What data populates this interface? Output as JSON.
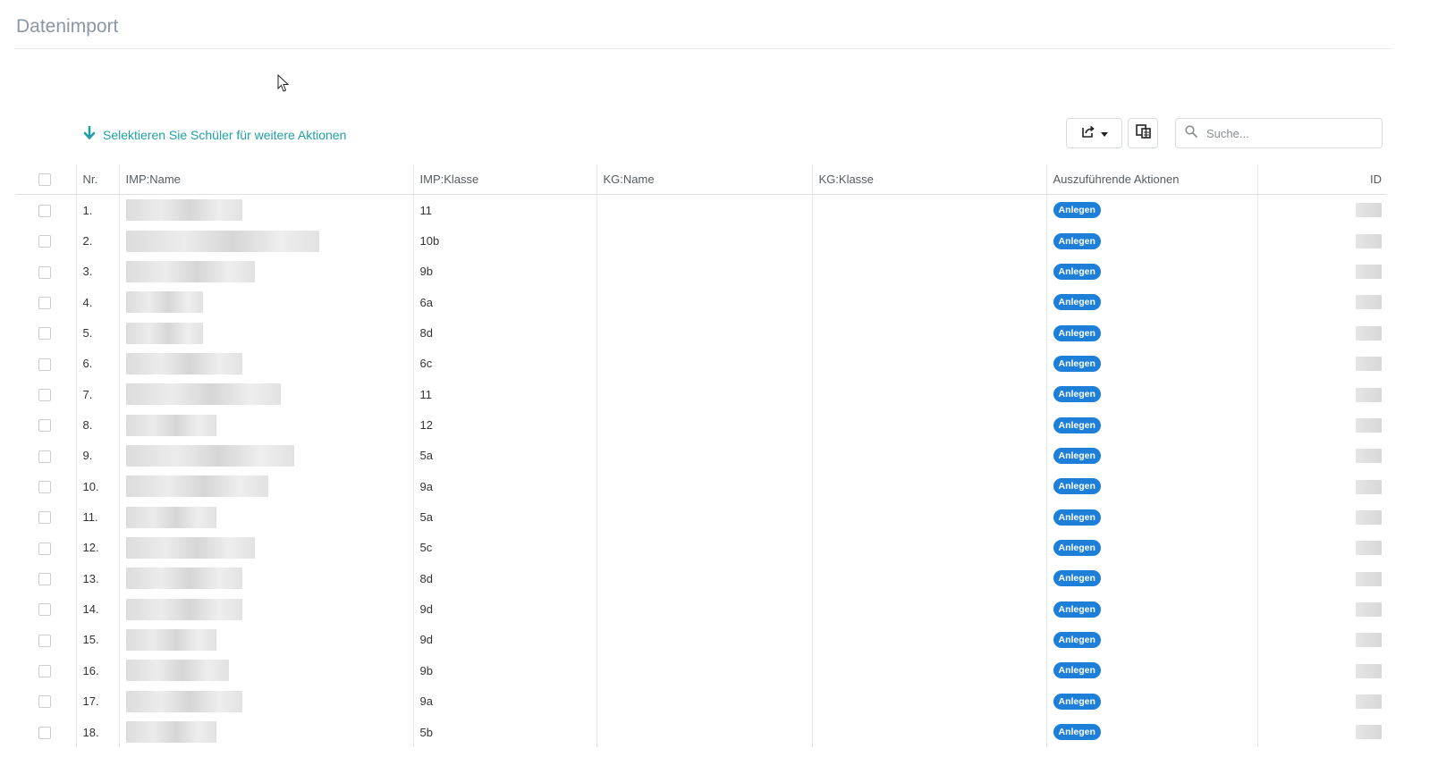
{
  "page": {
    "title": "Datenimport"
  },
  "toolbar": {
    "select_hint": "Selektieren Sie Schüler für weitere Aktionen",
    "search_placeholder": "Suche..."
  },
  "table": {
    "headers": {
      "nr": "Nr.",
      "imp_name": "IMP:Name",
      "imp_klasse": "IMP:Klasse",
      "kg_name": "KG:Name",
      "kg_klasse": "KG:Klasse",
      "actions": "Auszuführende Aktionen",
      "id": "ID"
    },
    "rows": [
      {
        "nr": "1.",
        "imp_klasse": "11",
        "action": "Anlegen"
      },
      {
        "nr": "2.",
        "imp_klasse": "10b",
        "action": "Anlegen"
      },
      {
        "nr": "3.",
        "imp_klasse": "9b",
        "action": "Anlegen"
      },
      {
        "nr": "4.",
        "imp_klasse": "6a",
        "action": "Anlegen"
      },
      {
        "nr": "5.",
        "imp_klasse": "8d",
        "action": "Anlegen"
      },
      {
        "nr": "6.",
        "imp_klasse": "6c",
        "action": "Anlegen"
      },
      {
        "nr": "7.",
        "imp_klasse": "11",
        "action": "Anlegen"
      },
      {
        "nr": "8.",
        "imp_klasse": "12",
        "action": "Anlegen"
      },
      {
        "nr": "9.",
        "imp_klasse": "5a",
        "action": "Anlegen"
      },
      {
        "nr": "10.",
        "imp_klasse": "9a",
        "action": "Anlegen"
      },
      {
        "nr": "11.",
        "imp_klasse": "5a",
        "action": "Anlegen"
      },
      {
        "nr": "12.",
        "imp_klasse": "5c",
        "action": "Anlegen"
      },
      {
        "nr": "13.",
        "imp_klasse": "8d",
        "action": "Anlegen"
      },
      {
        "nr": "14.",
        "imp_klasse": "9d",
        "action": "Anlegen"
      },
      {
        "nr": "15.",
        "imp_klasse": "9d",
        "action": "Anlegen"
      },
      {
        "nr": "16.",
        "imp_klasse": "9b",
        "action": "Anlegen"
      },
      {
        "nr": "17.",
        "imp_klasse": "9a",
        "action": "Anlegen"
      },
      {
        "nr": "18.",
        "imp_klasse": "5b",
        "action": "Anlegen"
      }
    ]
  },
  "icons": {
    "select_hint": "arrow-down-icon",
    "export": "export-icon",
    "columns": "columns-icon",
    "search": "search-icon"
  },
  "colors": {
    "accent": "#22a0a5",
    "badge": "#1d7fd8",
    "title": "#8a97a5"
  }
}
